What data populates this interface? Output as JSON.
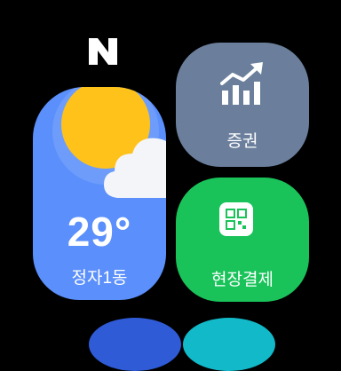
{
  "brand": {
    "icon": "naver-n-logo",
    "color": "#ffffff"
  },
  "weather": {
    "temperature": "29°",
    "location": "정자1동",
    "condition_icon": "sun-behind-cloud-icon",
    "background": "#5b8ffb"
  },
  "stocks": {
    "label": "증권",
    "icon": "chart-up-icon",
    "background": "#6b7f9c"
  },
  "pay": {
    "label": "현장결제",
    "icon": "qr-code-icon",
    "background": "#19c35a"
  },
  "peek_tiles": {
    "left_color": "#2f5bd6",
    "right_color": "#12b9c9"
  }
}
